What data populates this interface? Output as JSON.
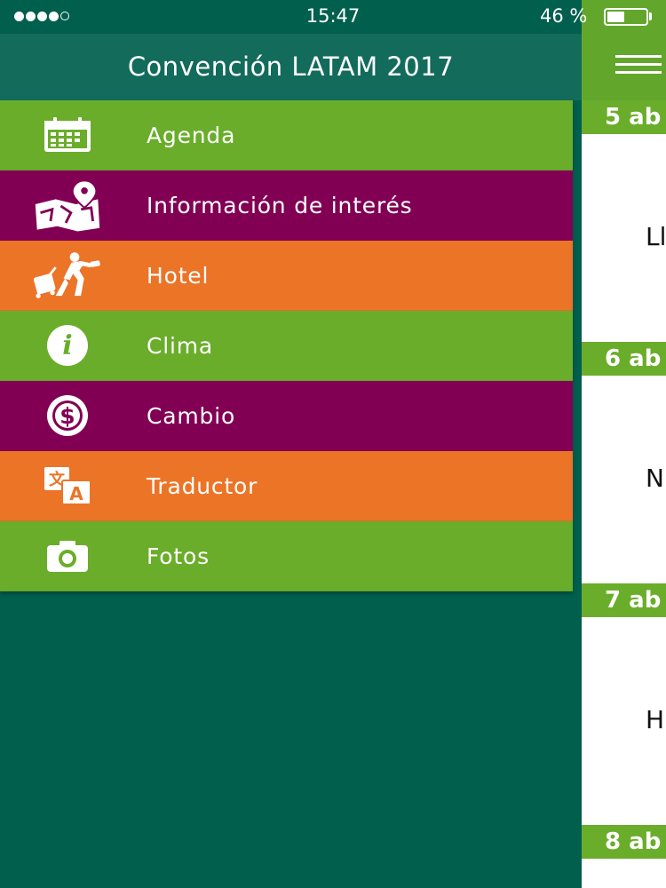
{
  "status_bar": {
    "signal_bars_filled": 4,
    "signal_bars_total": 5,
    "time": "15:47",
    "battery_text": "46 %",
    "battery_level": 0.46
  },
  "drawer": {
    "title": "Convención LATAM 2017",
    "items": [
      {
        "label": "Agenda",
        "icon": "calendar-icon",
        "color": "#6aad2a"
      },
      {
        "label": "Información de interés",
        "icon": "map-pin-icon",
        "color": "#820054"
      },
      {
        "label": "Hotel",
        "icon": "traveler-luggage-icon",
        "color": "#ec7427"
      },
      {
        "label": "Clima",
        "icon": "info-icon",
        "color": "#6aad2a"
      },
      {
        "label": "Cambio",
        "icon": "dollar-icon",
        "color": "#820054"
      },
      {
        "label": "Traductor",
        "icon": "translate-icon",
        "color": "#ec7427"
      },
      {
        "label": "Fotos",
        "icon": "camera-icon",
        "color": "#6aad2a"
      }
    ]
  },
  "main": {
    "header_color": "#62a72c",
    "agenda": [
      {
        "date": "5 ab",
        "event": "Ll"
      },
      {
        "date": "6 ab",
        "event": "N"
      },
      {
        "date": "7 ab",
        "event": "H"
      },
      {
        "date": "8 ab"
      }
    ]
  },
  "colors": {
    "drawer_background": "#015f4d",
    "drawer_header": "#136b5b",
    "green": "#6aad2a",
    "purple": "#820054",
    "orange": "#ec7427"
  }
}
